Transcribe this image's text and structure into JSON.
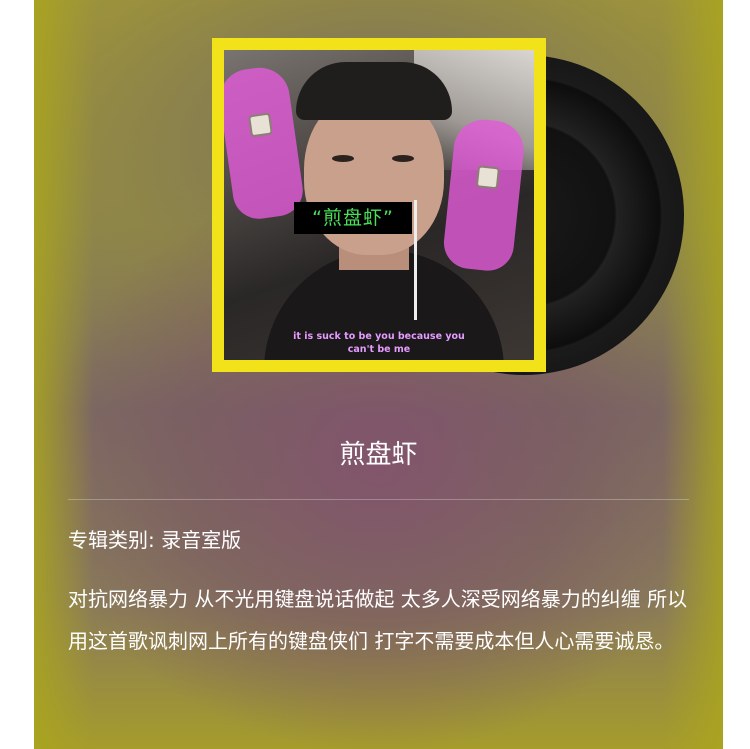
{
  "album": {
    "cover_tag": "“煎盘虾”",
    "cover_caption_line1": "it is suck to be you because you",
    "cover_caption_line2": "can't be me",
    "title": "煎盘虾",
    "category_label": "专辑类别: 录音室版",
    "description": "对抗网络暴力 从不光用键盘说话做起 太多人深受网络暴力的纠缠 所以用这首歌讽刺网上所有的键盘侠们 打字不需要成本但人心需要诚恳。"
  },
  "colors": {
    "cover_frame": "#f2e21a",
    "tag_text": "#49e05a",
    "caption_text": "#e59bff",
    "hands": "#e15ad7"
  },
  "icons": {
    "vinyl": "vinyl-record-icon"
  }
}
